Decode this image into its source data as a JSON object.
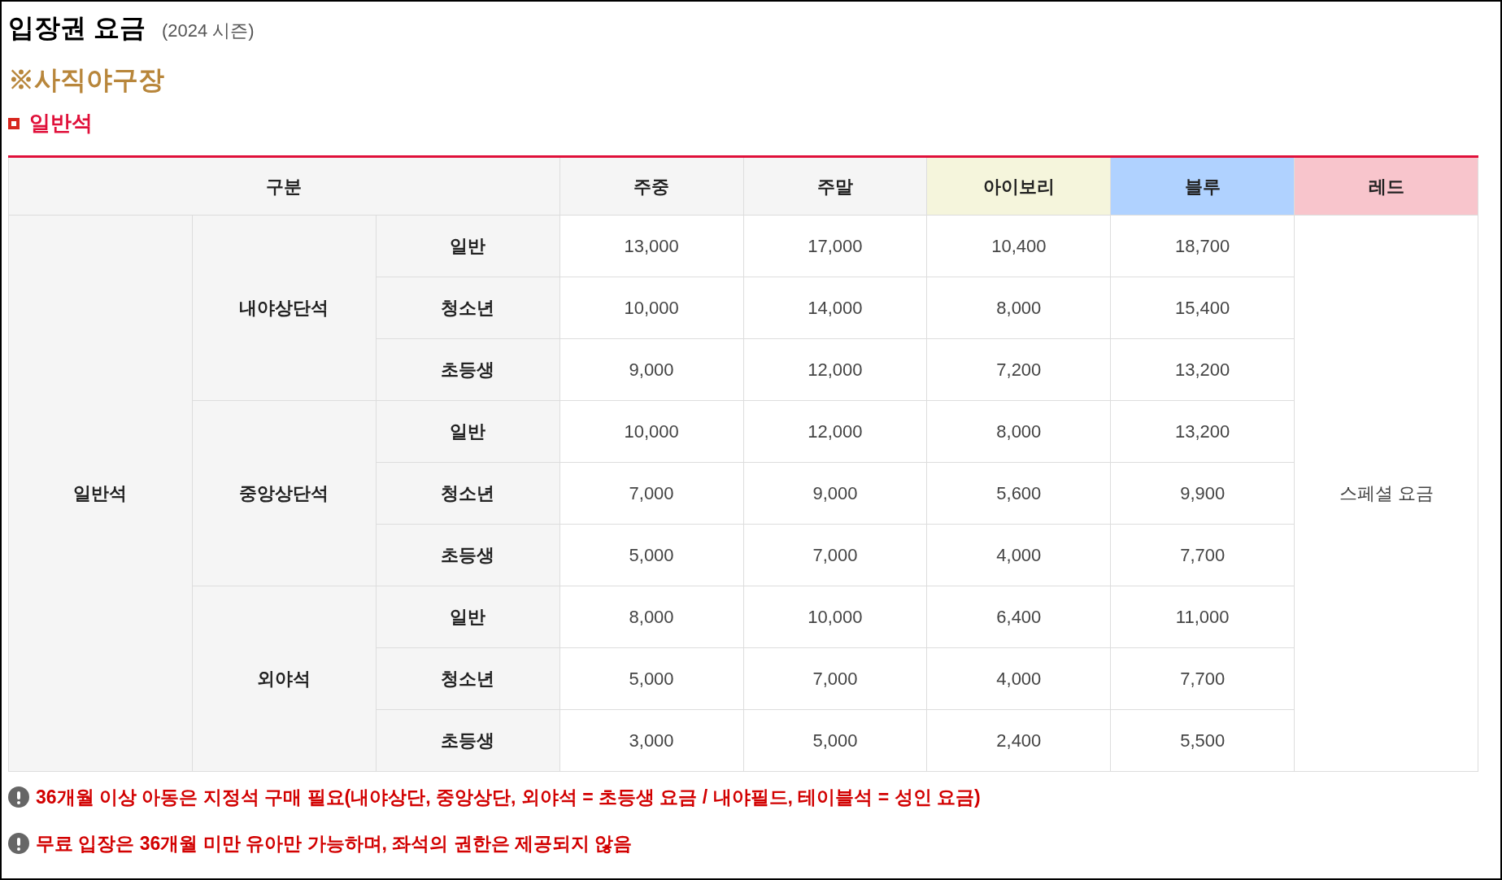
{
  "title": "입장권 요금",
  "season": "(2024 시즌)",
  "venue": "※사직야구장",
  "section": "일반석",
  "table": {
    "group_heading": "구분",
    "columns": [
      {
        "label": "주중",
        "color": "#f5f5f5"
      },
      {
        "label": "주말",
        "color": "#f5f5f5"
      },
      {
        "label": "아이보리",
        "color": "#f5f5dc"
      },
      {
        "label": "블루",
        "color": "#b0d2ff"
      },
      {
        "label": "레드",
        "color": "#f8c5cc"
      }
    ],
    "categories": [
      {
        "label": "일반석",
        "groups": [
          {
            "label": "내야상단석",
            "rows": [
              {
                "label": "일반",
                "prices": [
                  "13,000",
                  "17,000",
                  "10,400",
                  "18,700"
                ]
              },
              {
                "label": "청소년",
                "prices": [
                  "10,000",
                  "14,000",
                  "8,000",
                  "15,400"
                ]
              },
              {
                "label": "초등생",
                "prices": [
                  "9,000",
                  "12,000",
                  "7,200",
                  "13,200"
                ]
              }
            ]
          },
          {
            "label": "중앙상단석",
            "rows": [
              {
                "label": "일반",
                "prices": [
                  "10,000",
                  "12,000",
                  "8,000",
                  "13,200"
                ]
              },
              {
                "label": "청소년",
                "prices": [
                  "7,000",
                  "9,000",
                  "5,600",
                  "9,900"
                ]
              },
              {
                "label": "초등생",
                "prices": [
                  "5,000",
                  "7,000",
                  "4,000",
                  "7,700"
                ]
              }
            ]
          },
          {
            "label": "외야석",
            "rows": [
              {
                "label": "일반",
                "prices": [
                  "8,000",
                  "10,000",
                  "6,400",
                  "11,000"
                ]
              },
              {
                "label": "청소년",
                "prices": [
                  "5,000",
                  "7,000",
                  "4,000",
                  "7,700"
                ]
              },
              {
                "label": "초등생",
                "prices": [
                  "3,000",
                  "5,000",
                  "2,400",
                  "5,500"
                ]
              }
            ]
          }
        ]
      }
    ],
    "merged_price": "스페셜 요금"
  },
  "notes": [
    "36개월 이상 아동은 지정석 구매 필요(내야상단, 중앙상단, 외야석 = 초등생 요금 / 내야필드, 테이블석 = 성인 요금)",
    "무료 입장은 36개월 미만 유아만 가능하며, 좌석의 권한은 제공되지 않음"
  ]
}
